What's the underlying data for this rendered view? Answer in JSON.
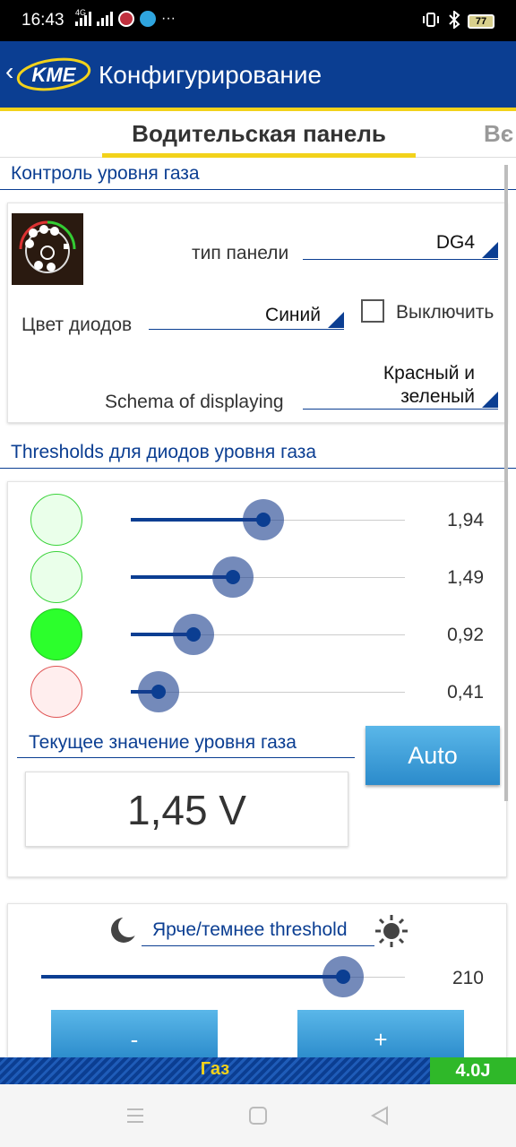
{
  "status_bar": {
    "time": "16:43",
    "network": "4G",
    "battery": "77",
    "overflow": "···"
  },
  "app": {
    "logo_text": "KME",
    "title": "Конфигурирование"
  },
  "tabs": {
    "active": "Водительская панель",
    "next": "Вє"
  },
  "gas_level_control": {
    "section_title": "Контроль уровня газа",
    "panel_type_label": "тип панели",
    "panel_type_value": "DG4",
    "diode_color_label": "Цвет диодов",
    "diode_color_value": "Синий",
    "disable_label": "Выключить",
    "disable_checked": false,
    "schema_label": "Schema of displaying",
    "schema_value_line1": "Красный и",
    "schema_value_line2": "зеленый"
  },
  "thresholds": {
    "section_title": "Thresholds для диодов уровня газа",
    "slider_max": 4.0,
    "items": [
      {
        "led_color": "#eaffea",
        "led_border": "#3bd33b",
        "value": 1.94,
        "value_text": "1,94"
      },
      {
        "led_color": "#eaffea",
        "led_border": "#3bd33b",
        "value": 1.49,
        "value_text": "1,49"
      },
      {
        "led_color": "#2cff2c",
        "led_border": "#22c422",
        "value": 0.92,
        "value_text": "0,92"
      },
      {
        "led_color": "#ffeeee",
        "led_border": "#e05555",
        "value": 0.41,
        "value_text": "0,41"
      }
    ],
    "current_label": "Текущее значение уровня газа",
    "current_value": "1,45 V",
    "auto_button": "Auto"
  },
  "brightness": {
    "label": "Ярче/темнее threshold",
    "value": "210",
    "fraction": 0.83,
    "minus_button": "-",
    "plus_button": "+"
  },
  "footer": {
    "fuel": "Газ",
    "version": "4.0J"
  },
  "colors": {
    "brand_blue": "#0b3e92",
    "accent_yellow": "#f2d21b",
    "button_blue": "#3a9fd8",
    "version_green": "#2fb829"
  }
}
